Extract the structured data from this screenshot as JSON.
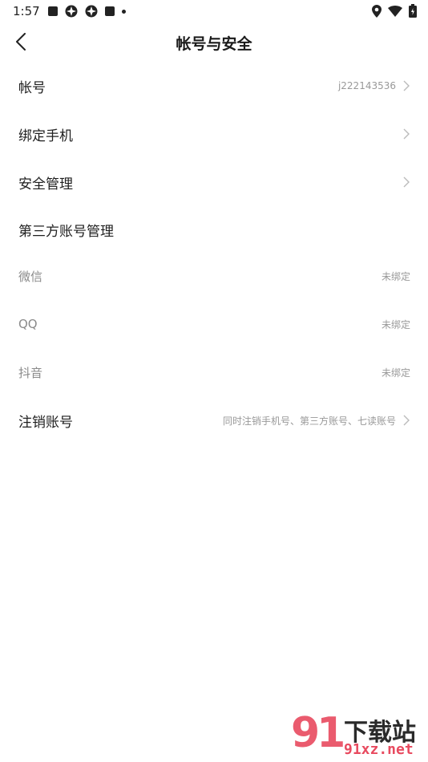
{
  "status_bar": {
    "time": "1:57"
  },
  "header": {
    "title": "帐号与安全"
  },
  "rows": [
    {
      "label": "帐号",
      "value": "j222143536"
    },
    {
      "label": "绑定手机",
      "value": ""
    },
    {
      "label": "安全管理",
      "value": ""
    },
    {
      "label": "第三方账号管理",
      "value": ""
    },
    {
      "label": "微信",
      "value": "未绑定"
    },
    {
      "label": "QQ",
      "value": "未绑定"
    },
    {
      "label": "抖音",
      "value": "未绑定"
    },
    {
      "label": "注销账号",
      "value": "同时注销手机号、第三方账号、七读账号"
    }
  ],
  "watermark": {
    "logo_digits": "91",
    "site_cn": "下载站",
    "site_domain": "91xz.net"
  }
}
